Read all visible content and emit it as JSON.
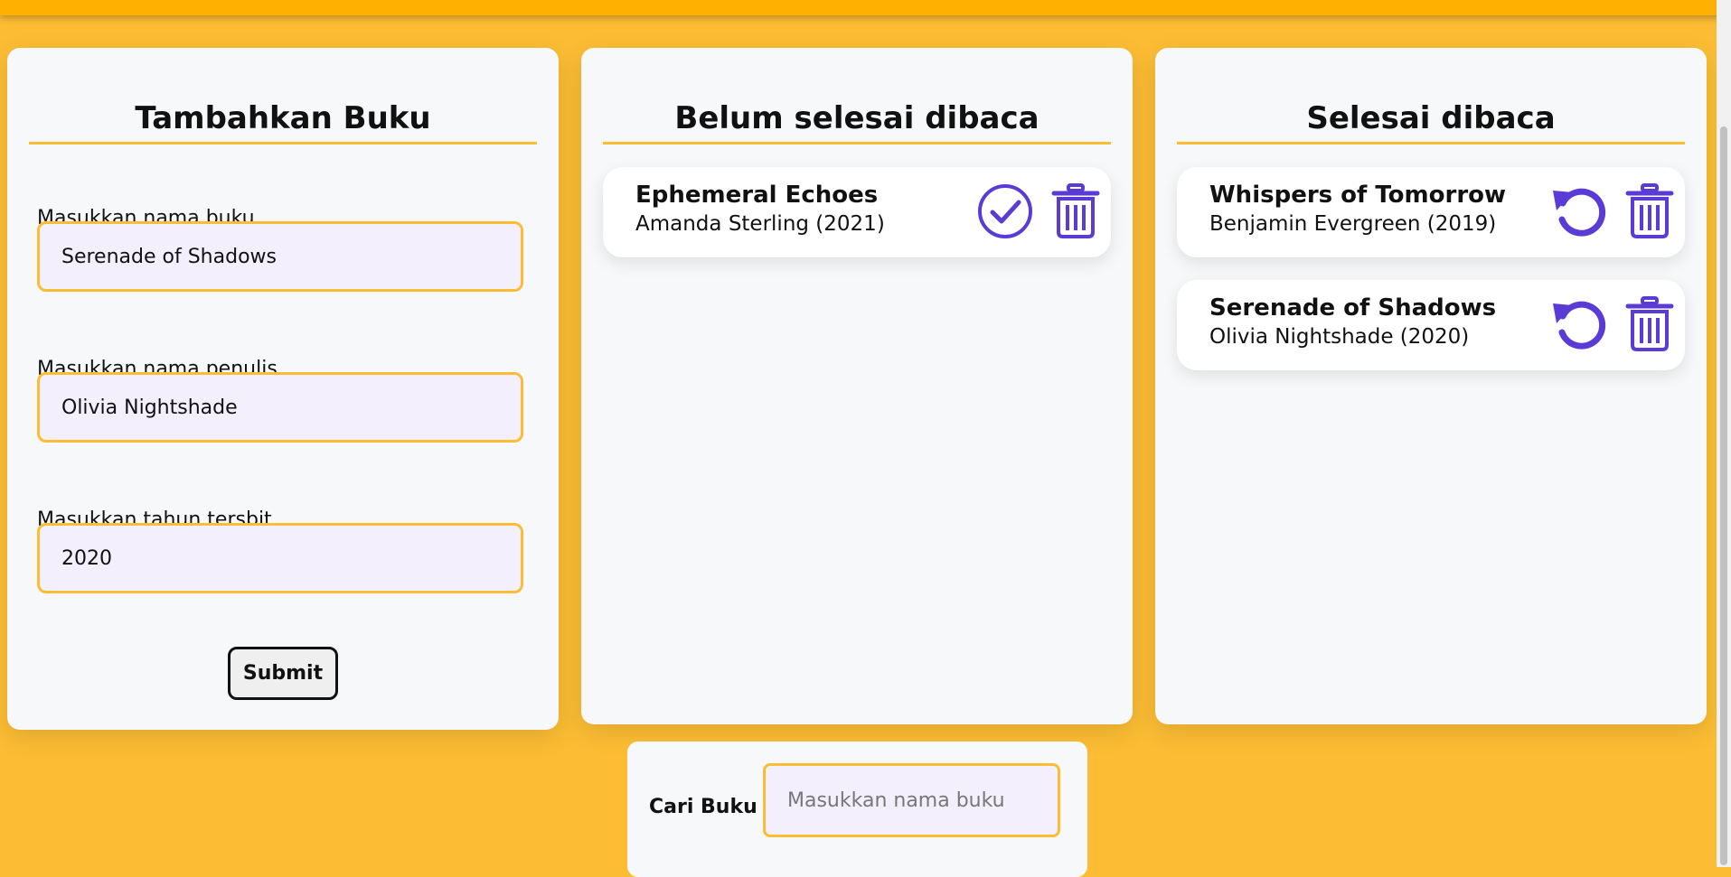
{
  "colors": {
    "background": "#fcbd34",
    "topbar": "#ffb000",
    "panel": "#f7f8fa",
    "accent_icon": "#5b3bd6",
    "input_bg": "#f3effc",
    "input_border": "#fcbd34"
  },
  "add_form": {
    "title": "Tambahkan Buku",
    "fields": [
      {
        "label": "Masukkan nama buku",
        "value": "Serenade of Shadows"
      },
      {
        "label": "Masukkan nama penulis",
        "value": "Olivia Nightshade"
      },
      {
        "label": "Masukkan tahun tersbit",
        "value": "2020"
      }
    ],
    "submit_label": "Submit"
  },
  "unread": {
    "title": "Belum selesai dibaca",
    "books": [
      {
        "title": "Ephemeral Echoes",
        "meta": "Amanda Sterling (2021)",
        "actions": [
          "check-circle-icon",
          "trash-icon"
        ]
      }
    ]
  },
  "read": {
    "title": "Selesai dibaca",
    "books": [
      {
        "title": "Whispers of Tomorrow",
        "meta": "Benjamin Evergreen (2019)",
        "actions": [
          "undo-icon",
          "trash-icon"
        ]
      },
      {
        "title": "Serenade of Shadows",
        "meta": "Olivia Nightshade (2020)",
        "actions": [
          "undo-icon",
          "trash-icon"
        ]
      }
    ]
  },
  "search": {
    "label": "Cari Buku",
    "placeholder": "Masukkan nama buku",
    "value": ""
  }
}
